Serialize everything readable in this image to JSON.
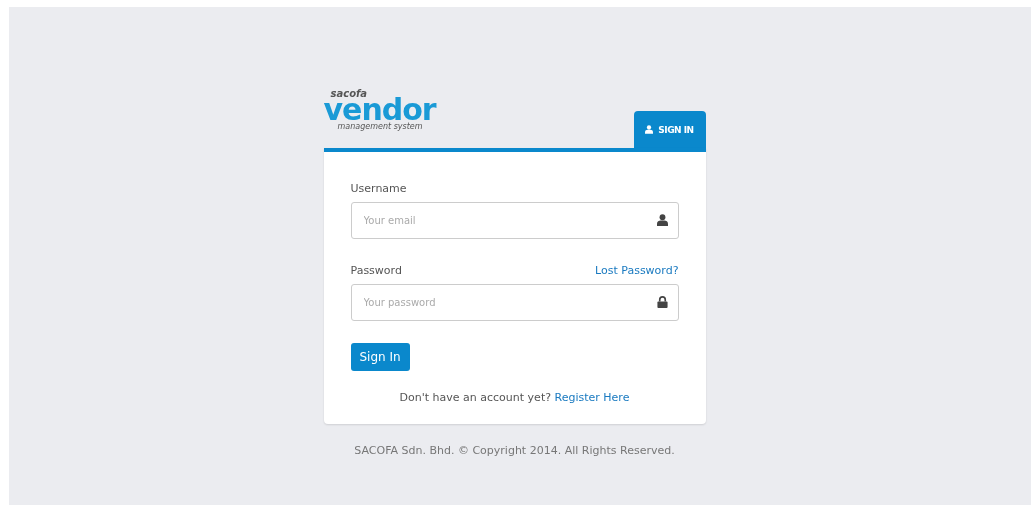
{
  "logo": {
    "brand": "sacofa",
    "name": "vendor",
    "tagline": "management system"
  },
  "tabs": [
    {
      "label": "SIGN IN",
      "selected": true
    }
  ],
  "form": {
    "fields": [
      {
        "label": "Username",
        "placeholder": "Your email",
        "kind": "user"
      },
      {
        "label": "Password",
        "placeholder": "Your password",
        "kind": "lock",
        "link": "Lost Password?"
      }
    ],
    "submit": "Sign In",
    "register": {
      "prompt": "Don't have an account yet?",
      "link": "Register Here"
    }
  },
  "footer": "SACOFA Sdn. Bhd. © Copyright 2014. All Rights Reserved."
}
